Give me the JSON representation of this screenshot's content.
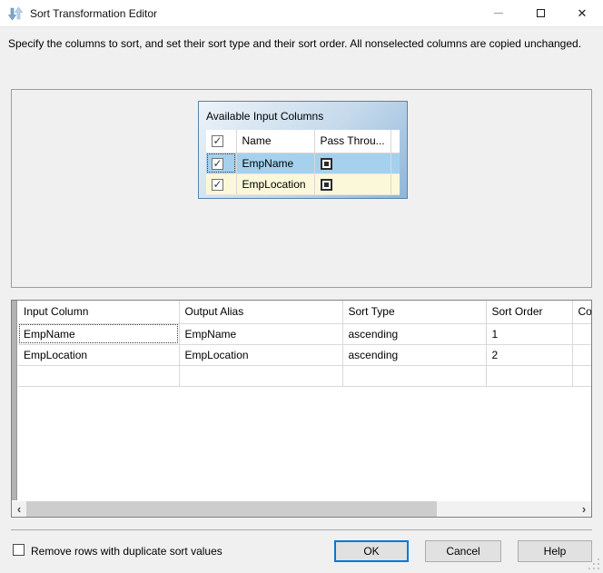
{
  "window": {
    "title": "Sort Transformation Editor"
  },
  "description": "Specify the columns to sort, and set their sort type and their sort order. All nonselected columns are copied unchanged.",
  "glyphs": {
    "close": "✕",
    "check": "✓",
    "scroll_left": "‹",
    "scroll_right": "›"
  },
  "available_columns": {
    "title": "Available Input Columns",
    "headers": {
      "name": "Name",
      "pass_through": "Pass Throu..."
    },
    "rows": [
      {
        "name": "EmpName",
        "checked": true,
        "pass_through": true,
        "selected": true
      },
      {
        "name": "EmpLocation",
        "checked": true,
        "pass_through": true,
        "selected": false
      }
    ]
  },
  "sort_grid": {
    "headers": [
      "Input Column",
      "Output Alias",
      "Sort Type",
      "Sort Order",
      "Com"
    ],
    "rows": [
      [
        "EmpName",
        "EmpName",
        "ascending",
        "1",
        ""
      ],
      [
        "EmpLocation",
        "EmpLocation",
        "ascending",
        "2",
        ""
      ]
    ]
  },
  "footer": {
    "duplicate_checkbox_label": "Remove rows with duplicate sort values",
    "duplicate_checkbox_checked": false,
    "ok_label": "OK",
    "cancel_label": "Cancel",
    "help_label": "Help"
  },
  "colors": {
    "accent_blue": "#0078D7",
    "selected_row_blue": "#A5D1EE",
    "alt_row_yellow": "#FAF8D9",
    "box_border_blue": "#5585AC",
    "box_gradient_top": "#EDF3F9",
    "box_gradient_bottom": "#8FB6D9",
    "dialog_background": "#F0F0F0"
  }
}
